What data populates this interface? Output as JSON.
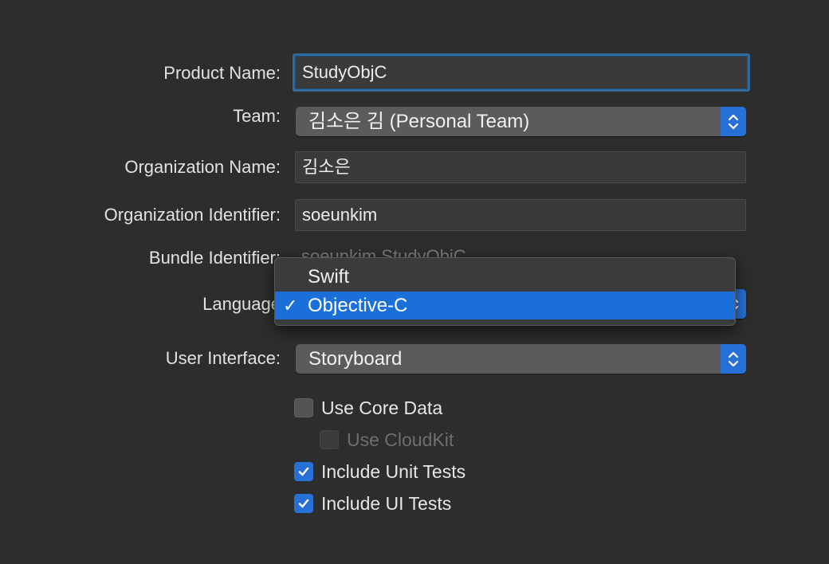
{
  "form": {
    "product_name_label": "Product Name:",
    "product_name_value": "StudyObjC",
    "team_label": "Team:",
    "team_value": "김소은 김 (Personal Team)",
    "org_name_label": "Organization Name:",
    "org_name_value": "김소은",
    "org_id_label": "Organization Identifier:",
    "org_id_value": "soeunkim",
    "bundle_id_label": "Bundle Identifier:",
    "bundle_id_value": "soeunkim.StudyObjC",
    "language_label": "Language",
    "user_interface_label": "User Interface:",
    "user_interface_value": "Storyboard"
  },
  "language_menu": {
    "items": [
      {
        "label": "Swift",
        "selected": false
      },
      {
        "label": "Objective-C",
        "selected": true
      }
    ],
    "check_glyph": "✓"
  },
  "options": [
    {
      "label": "Use Core Data",
      "checked": false,
      "disabled": false
    },
    {
      "label": "Use CloudKit",
      "checked": false,
      "disabled": true
    },
    {
      "label": "Include Unit Tests",
      "checked": true,
      "disabled": false
    },
    {
      "label": "Include UI Tests",
      "checked": true,
      "disabled": false
    }
  ],
  "colors": {
    "background": "#2d2d2d",
    "accent": "#2770d6",
    "menu_selection": "#1a6fd9",
    "focus_ring": "#2e6b9c"
  },
  "icons": {
    "stepper": "chevron-up-down-icon",
    "checkmark": "checkmark-icon"
  }
}
